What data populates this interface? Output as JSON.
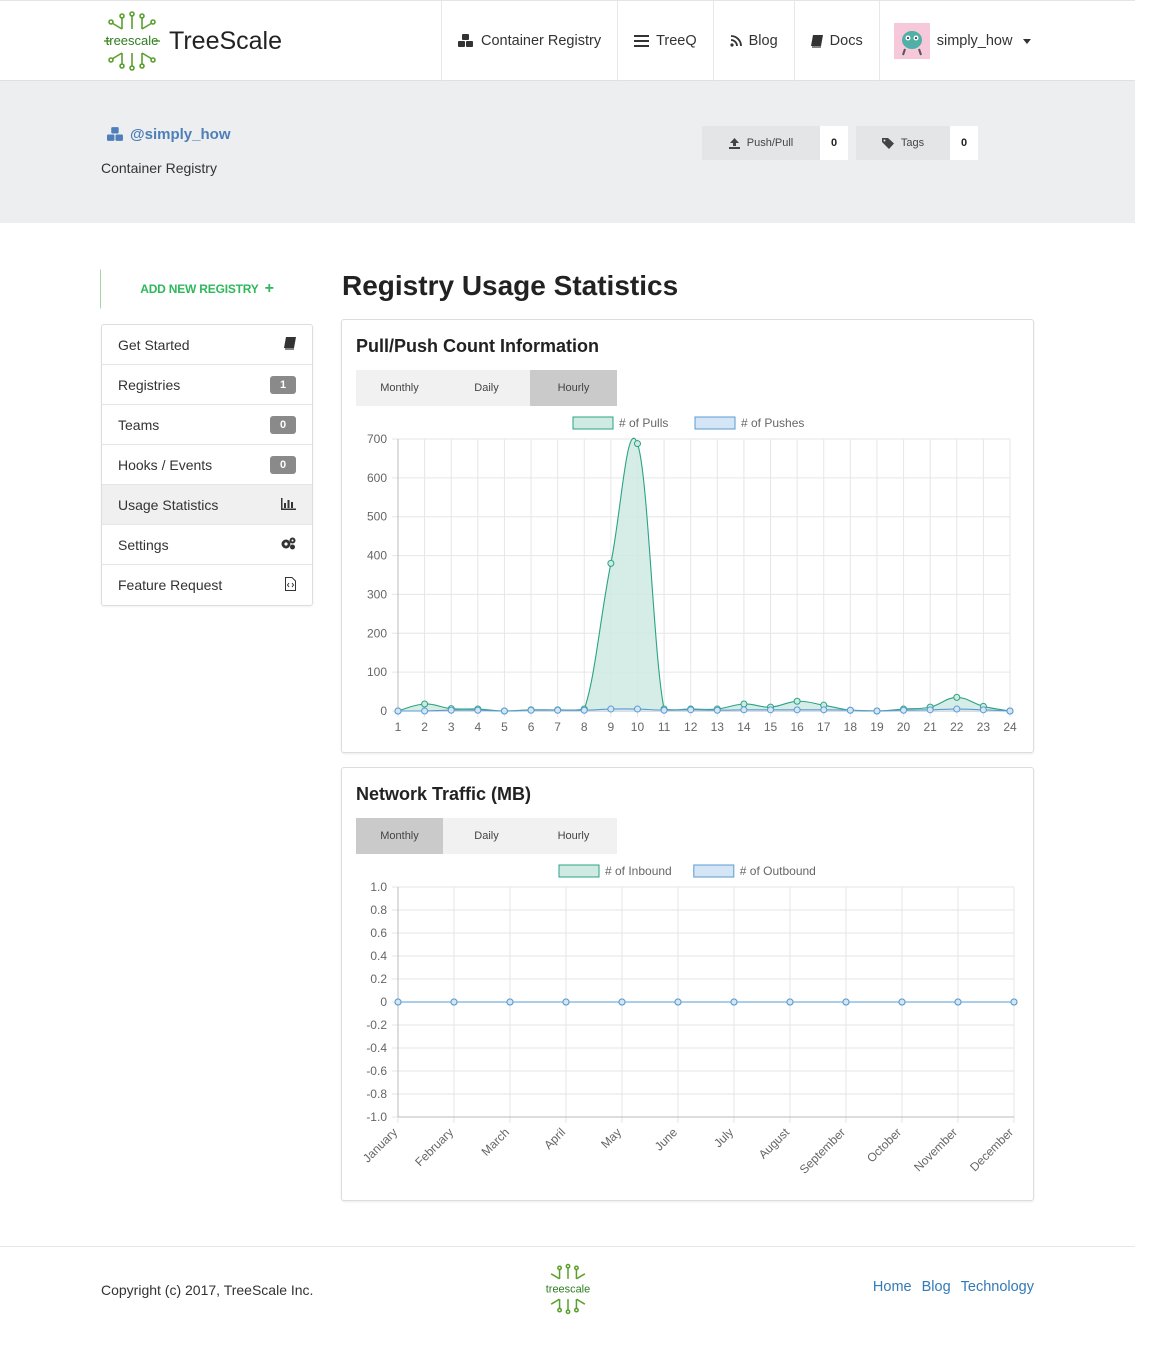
{
  "brand": {
    "logo_text": "treescale",
    "name": "TreeScale"
  },
  "nav": {
    "items": [
      {
        "label": "Container Registry",
        "icon": "cubes-icon"
      },
      {
        "label": "TreeQ",
        "icon": "list-icon"
      },
      {
        "label": "Blog",
        "icon": "rss-icon"
      },
      {
        "label": "Docs",
        "icon": "book-icon"
      }
    ],
    "user": "simply_how"
  },
  "profile": {
    "handle": "@simply_how",
    "subtitle": "Container Registry",
    "stats": [
      {
        "label": "Push/Pull",
        "value": "0",
        "icon": "upload-icon"
      },
      {
        "label": "Tags",
        "value": "0",
        "icon": "tag-icon"
      }
    ]
  },
  "sidebar": {
    "add_label": "ADD NEW REGISTRY",
    "items": [
      {
        "label": "Get Started",
        "icon": "book-icon"
      },
      {
        "label": "Registries",
        "badge": "1"
      },
      {
        "label": "Teams",
        "badge": "0"
      },
      {
        "label": "Hooks / Events",
        "badge": "0"
      },
      {
        "label": "Usage Statistics",
        "icon": "bar-chart-icon",
        "active": true
      },
      {
        "label": "Settings",
        "icon": "gears-icon"
      },
      {
        "label": "Feature Request",
        "icon": "code-file-icon"
      }
    ]
  },
  "main": {
    "title": "Registry Usage Statistics",
    "panels": [
      {
        "title": "Pull/Push Count Information",
        "tabs": [
          "Monthly",
          "Daily",
          "Hourly"
        ],
        "active_tab": "Hourly"
      },
      {
        "title": "Network Traffic (MB)",
        "tabs": [
          "Monthly",
          "Daily",
          "Hourly"
        ],
        "active_tab": "Monthly"
      }
    ]
  },
  "colors": {
    "series_a_fill": "#cfeae3",
    "series_a_line": "#2aa384",
    "series_b_fill": "#d4e6f5",
    "series_b_line": "#5a9bd1",
    "brand_green": "#2fb85b",
    "link": "#337ab7"
  },
  "chart_data": [
    {
      "type": "area",
      "x": [
        "1",
        "2",
        "3",
        "4",
        "5",
        "6",
        "7",
        "8",
        "9",
        "10",
        "11",
        "12",
        "13",
        "14",
        "15",
        "16",
        "17",
        "18",
        "19",
        "20",
        "21",
        "22",
        "23",
        "24"
      ],
      "series": [
        {
          "name": "# of Pulls",
          "values": [
            0,
            18,
            6,
            5,
            0,
            3,
            3,
            5,
            380,
            688,
            5,
            5,
            5,
            18,
            10,
            25,
            15,
            2,
            0,
            5,
            10,
            35,
            12,
            0
          ]
        },
        {
          "name": "# of Pushes",
          "values": [
            0,
            0,
            2,
            2,
            0,
            2,
            2,
            2,
            5,
            5,
            2,
            3,
            2,
            3,
            3,
            3,
            3,
            2,
            0,
            2,
            3,
            5,
            3,
            0
          ]
        }
      ],
      "ylim": [
        0,
        700
      ],
      "yticks": [
        0,
        100,
        200,
        300,
        400,
        500,
        600,
        700
      ],
      "grid": true,
      "legend": "top"
    },
    {
      "type": "line",
      "x": [
        "January",
        "February",
        "March",
        "April",
        "May",
        "June",
        "July",
        "August",
        "September",
        "October",
        "November",
        "December"
      ],
      "series": [
        {
          "name": "# of Inbound",
          "values": [
            0,
            0,
            0,
            0,
            0,
            0,
            0,
            0,
            0,
            0,
            0,
            0
          ]
        },
        {
          "name": "# of Outbound",
          "values": [
            0,
            0,
            0,
            0,
            0,
            0,
            0,
            0,
            0,
            0,
            0,
            0
          ]
        }
      ],
      "ylim": [
        -1.0,
        1.0
      ],
      "yticks": [
        "1.0",
        "0.8",
        "0.6",
        "0.4",
        "0.2",
        "0",
        "-0.2",
        "-0.4",
        "-0.6",
        "-0.8",
        "-1.0"
      ],
      "grid": true,
      "legend": "top"
    }
  ],
  "footer": {
    "copyright": "Copyright (c) 2017, TreeScale Inc.",
    "links": [
      "Home",
      "Blog",
      "Technology"
    ]
  }
}
